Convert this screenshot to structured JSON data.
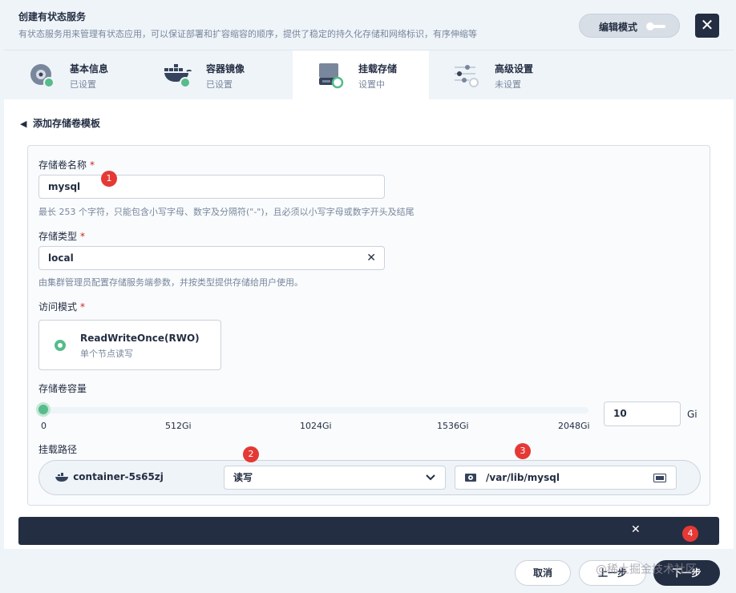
{
  "header": {
    "title": "创建有状态服务",
    "description": "有状态服务用来管理有状态应用，可以保证部署和扩容缩容的顺序，提供了稳定的持久化存储和网络标识，有序伸缩等",
    "edit_mode_label": "编辑模式"
  },
  "tabs": [
    {
      "name": "基本信息",
      "status": "已设置",
      "icon": "disk-icon"
    },
    {
      "name": "容器镜像",
      "status": "已设置",
      "icon": "docker-icon"
    },
    {
      "name": "挂载存储",
      "status": "设置中",
      "icon": "storage-icon"
    },
    {
      "name": "高级设置",
      "status": "未设置",
      "icon": "settings-sliders-icon"
    }
  ],
  "back_link": "添加存储卷模板",
  "form": {
    "volume_name_label": "存储卷名称",
    "volume_name_value": "mysql",
    "volume_name_hint": "最长 253 个字符，只能包含小写字母、数字及分隔符(\"-\")，且必须以小写字母或数字开头及结尾",
    "storage_class_label": "存储类型",
    "storage_class_value": "local",
    "storage_class_hint": "由集群管理员配置存储服务端参数，并按类型提供存储给用户使用。",
    "access_mode_label": "访问模式",
    "access_mode_name": "ReadWriteOnce(RWO)",
    "access_mode_desc": "单个节点读写",
    "capacity_label": "存储卷容量",
    "capacity_ticks": [
      "0",
      "512Gi",
      "1024Gi",
      "1536Gi",
      "2048Gi"
    ],
    "capacity_value": "10",
    "capacity_unit": "Gi",
    "mount_path_label": "挂载路径",
    "container_name": "container-5s65zj",
    "mount_mode": "读写",
    "mount_path": "/var/lib/mysql",
    "required_mark": "*"
  },
  "badges": [
    "1",
    "2",
    "3",
    "4"
  ],
  "footer": {
    "cancel": "取消",
    "prev": "上一步",
    "next": "下一步",
    "watermark": "@稀土掘金技术社区"
  },
  "colors": {
    "accent": "#55bc8a",
    "dark": "#242e42",
    "badge": "#e53935"
  }
}
